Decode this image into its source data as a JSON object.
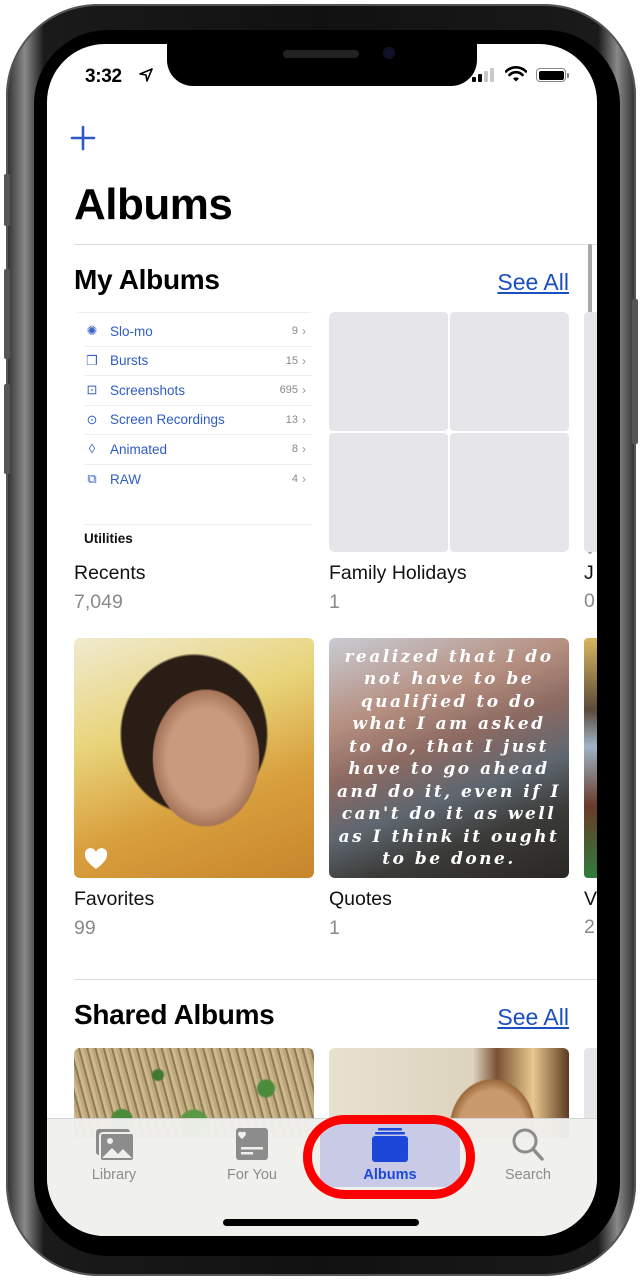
{
  "status_bar": {
    "time": "3:32",
    "location_icon": "location-arrow-icon",
    "signal_bars_active": 2,
    "signal_bars_total": 4,
    "battery_percent": 100
  },
  "nav": {
    "add_icon": "plus-icon"
  },
  "page_title": "Albums",
  "my_albums": {
    "title": "My Albums",
    "see_all": "See All",
    "recents_preview": {
      "rows": [
        {
          "icon": "slo-mo-icon",
          "label": "Slo-mo",
          "count": "9"
        },
        {
          "icon": "bursts-icon",
          "label": "Bursts",
          "count": "15"
        },
        {
          "icon": "screenshots-icon",
          "label": "Screenshots",
          "count": "695"
        },
        {
          "icon": "screen-recordings-icon",
          "label": "Screen Recordings",
          "count": "13"
        },
        {
          "icon": "animated-icon",
          "label": "Animated",
          "count": "8"
        },
        {
          "icon": "raw-icon",
          "label": "RAW",
          "count": "4"
        }
      ],
      "utilities_label": "Utilities"
    },
    "albums": [
      {
        "name": "Recents",
        "count": "7,049"
      },
      {
        "name": "Family Holidays",
        "count": "1"
      },
      {
        "name": "Favorites",
        "count": "99"
      },
      {
        "name": "Quotes",
        "count": "1",
        "quote_text": "realized that I do not have to be qualified to do what I am asked to do, that I just have to go ahead and do it, even if I can't do it as well as I think it ought to be done."
      }
    ],
    "partial_albums": [
      {
        "name_fragment": "J",
        "count_fragment": "0"
      },
      {
        "name_fragment": "V",
        "count_fragment": "2"
      }
    ]
  },
  "shared_albums": {
    "title": "Shared Albums",
    "see_all": "See All"
  },
  "tab_bar": {
    "tabs": [
      {
        "label": "Library",
        "icon": "library-icon",
        "active": false
      },
      {
        "label": "For You",
        "icon": "for-you-icon",
        "active": false
      },
      {
        "label": "Albums",
        "icon": "albums-icon",
        "active": true
      },
      {
        "label": "Search",
        "icon": "search-icon",
        "active": false
      }
    ],
    "active_color": "#1d47d8",
    "inactive_color": "#8c8c8c",
    "annotation_color": "#ff0000"
  },
  "colors": {
    "link": "#1a4fc4",
    "placeholder_tile": "#e5e5ea"
  }
}
